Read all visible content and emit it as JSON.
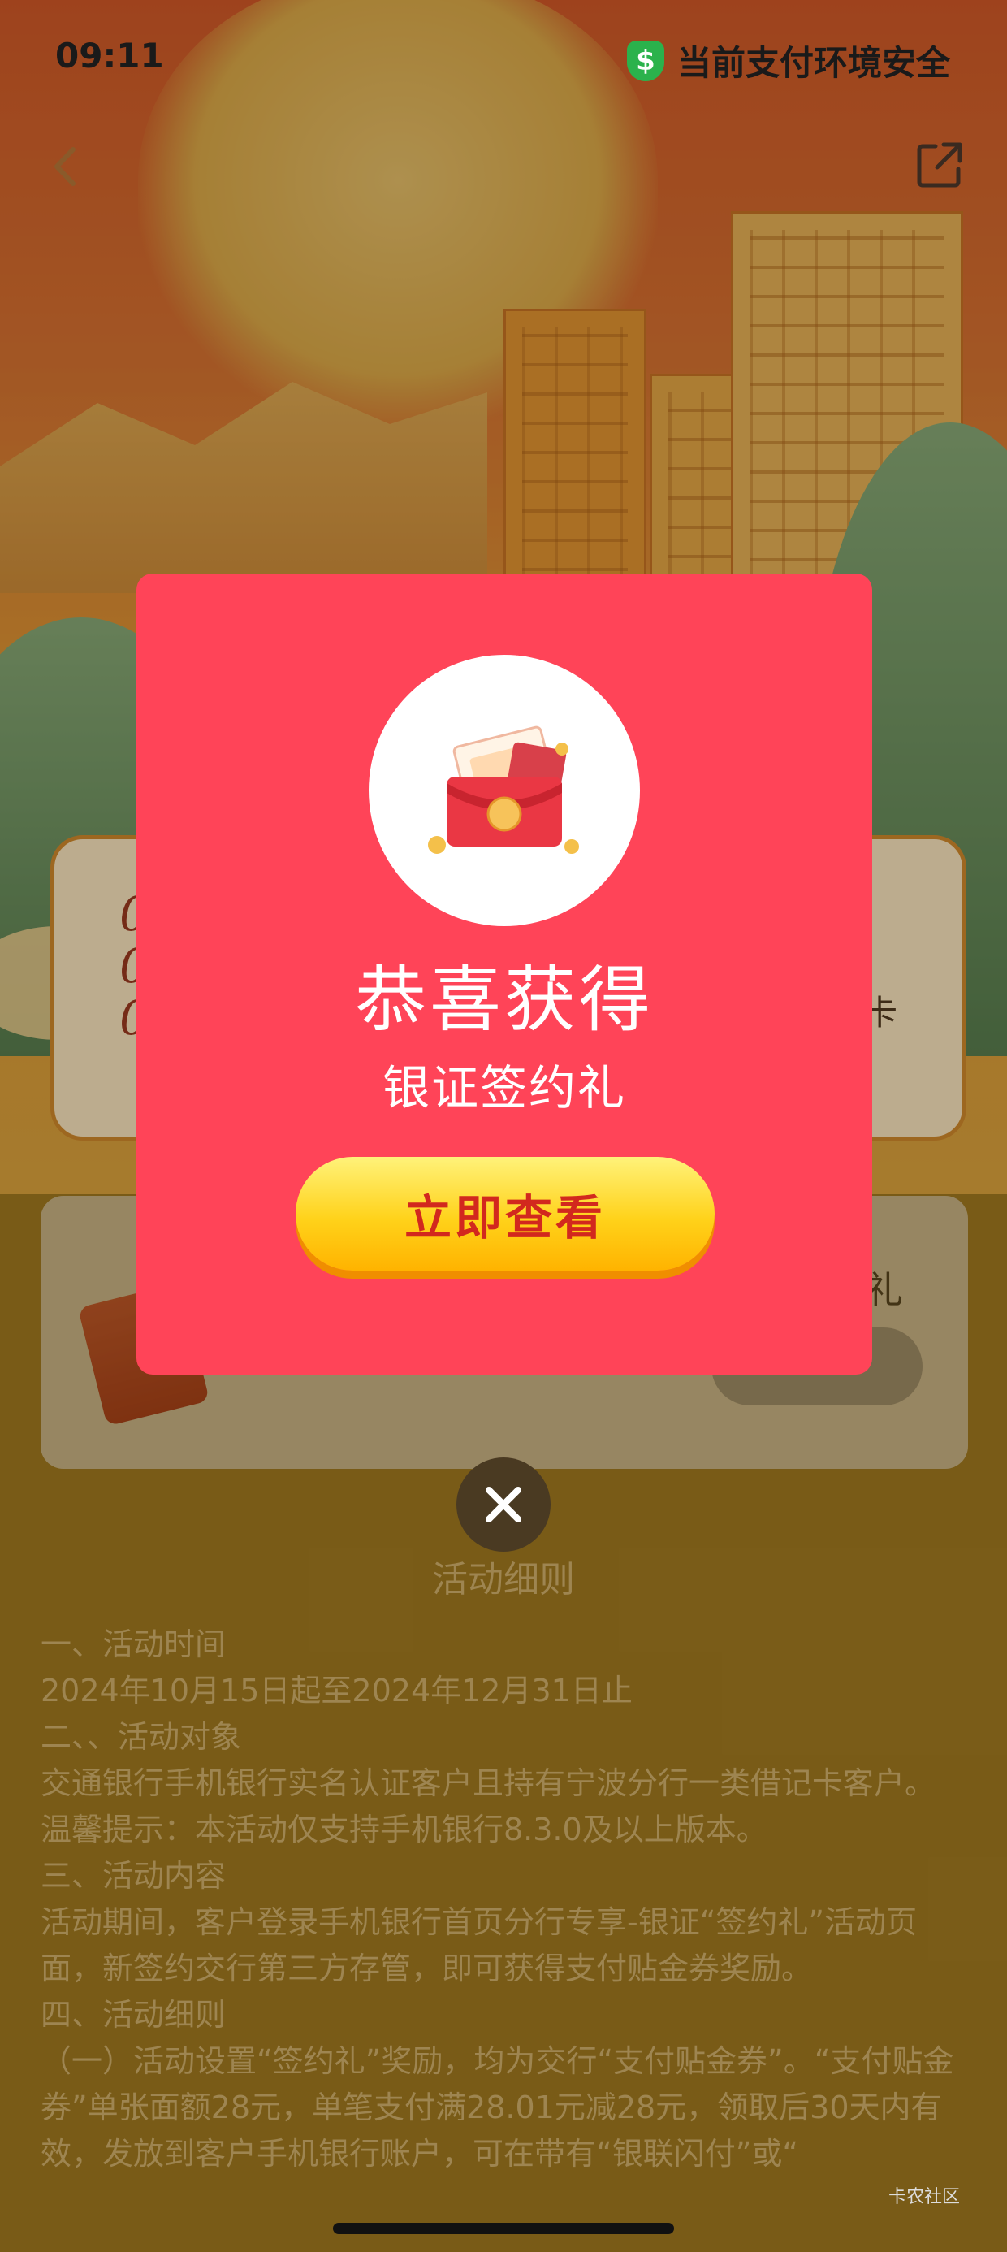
{
  "status_bar": {
    "time": "09:11",
    "security_text": "当前支付环境安全",
    "security_icon": "dollar-shield-icon"
  },
  "nav": {
    "back_icon": "chevron-left-icon",
    "share_icon": "share-icon"
  },
  "background": {
    "card_lines": [
      "0",
      "0",
      "0"
    ],
    "card_tail": "卡",
    "reward_title_tail": "礼"
  },
  "modal": {
    "icon": "red-envelope-coupon-icon",
    "title": "恭喜获得",
    "subtitle": "银证签约礼",
    "button_label": "立即查看",
    "close_icon": "close-icon"
  },
  "rules": {
    "title": "活动细则",
    "lines": [
      "一、活动时间",
      "2024年10月15日起至2024年12月31日止",
      "二、、活动对象",
      "交通银行手机银行实名认证客户且持有宁波分行一类借记卡客户。",
      "温馨提示：本活动仅支持手机银行8.3.0及以上版本。",
      "三、活动内容",
      "活动期间，客户登录手机银行首页分行专享-银证“签约礼”活动页面，新签约交行第三方存管，即可获得支付贴金券奖励。",
      "四、活动细则",
      "（一）活动设置“签约礼”奖励，均为交行“支付贴金券”。“支付贴金券”单张面额28元，单笔支付满28.01元减28元，领取后30天内有效，发放到客户手机银行账户，可在带有“银联闪付”或“"
    ]
  },
  "watermark": "卡农社区"
}
